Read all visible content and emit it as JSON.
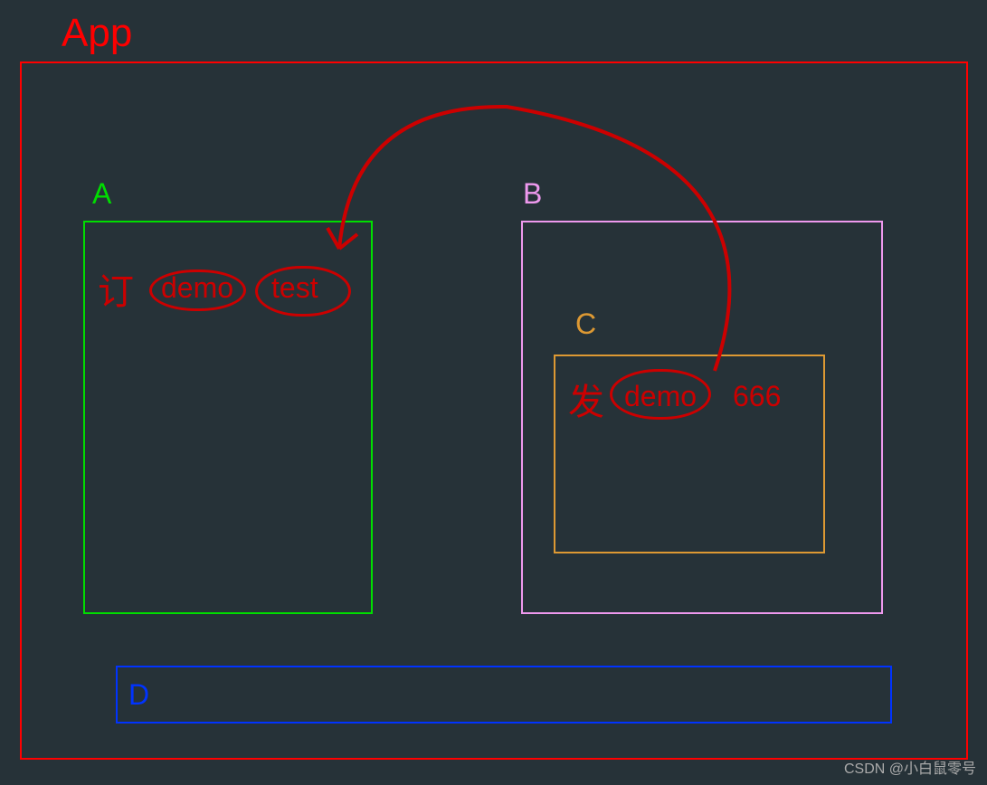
{
  "app": {
    "label": "App",
    "color": "#ff0000"
  },
  "boxes": {
    "A": {
      "label": "A",
      "color": "#00dd00",
      "annotation_char": "订",
      "annotation_word1": "demo",
      "annotation_word2": "test"
    },
    "B": {
      "label": "B",
      "color": "#ee99ee"
    },
    "C": {
      "label": "C",
      "color": "#dd9933",
      "annotation_char": "发",
      "annotation_word1": "demo",
      "annotation_word2": "666"
    },
    "D": {
      "label": "D",
      "color": "#0033ff"
    }
  },
  "watermark": "CSDN @小白鼠零号"
}
